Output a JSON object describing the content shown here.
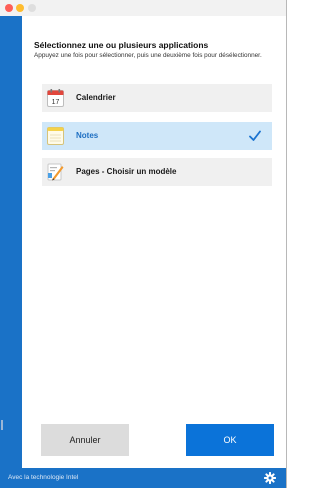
{
  "dialog": {
    "heading": "Sélectionnez une ou plusieurs applications",
    "instructions": "Appuyez une fois pour sélectionner, puis une deuxième fois pour désélectionner."
  },
  "apps": [
    {
      "label": "Calendrier",
      "icon": "calendar-icon",
      "calendar_day": "17",
      "selected": false
    },
    {
      "label": "Notes",
      "icon": "notes-icon",
      "selected": true
    },
    {
      "label": "Pages - Choisir un modèle",
      "icon": "pages-icon",
      "selected": false
    }
  ],
  "buttons": {
    "cancel_label": "Annuler",
    "ok_label": "OK"
  },
  "footer": {
    "powered_by": "Avec la technologie Intel",
    "icon": "gear-icon"
  },
  "colors": {
    "accent": "#0b73d9",
    "band": "#1a72c7",
    "selected_row": "#cfe7f9",
    "row": "#f0f0f0"
  }
}
